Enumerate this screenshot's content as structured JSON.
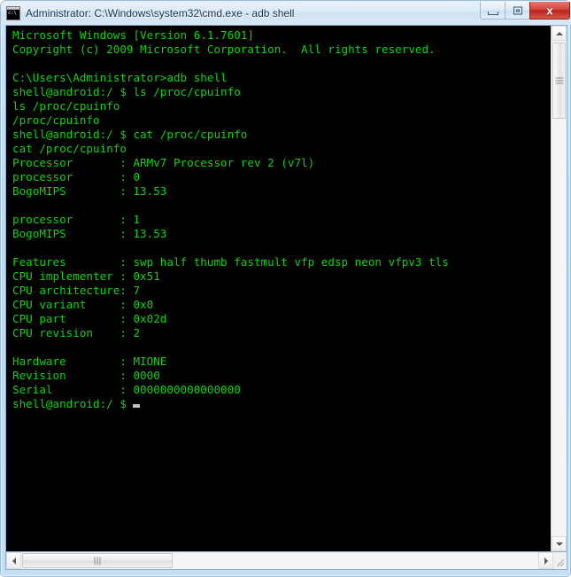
{
  "window": {
    "title": "Administrator: C:\\Windows\\system32\\cmd.exe - adb  shell",
    "icon": "cmd-console-icon",
    "frame_color": "#c6ddf2",
    "controls": {
      "minimize_label": "",
      "maximize_label": "",
      "close_label": "x"
    }
  },
  "console": {
    "background_color": "#000000",
    "text_color": "#12d412",
    "cursor_color": "#c4c4c4",
    "lines": [
      "Microsoft Windows [Version 6.1.7601]",
      "Copyright (c) 2009 Microsoft Corporation.  All rights reserved.",
      "",
      "C:\\Users\\Administrator>adb shell",
      "shell@android:/ $ ls /proc/cpuinfo",
      "ls /proc/cpuinfo",
      "/proc/cpuinfo",
      "shell@android:/ $ cat /proc/cpuinfo",
      "cat /proc/cpuinfo",
      "Processor       : ARMv7 Processor rev 2 (v7l)",
      "processor       : 0",
      "BogoMIPS        : 13.53",
      "",
      "processor       : 1",
      "BogoMIPS        : 13.53",
      "",
      "Features        : swp half thumb fastmult vfp edsp neon vfpv3 tls",
      "CPU implementer : 0x51",
      "CPU architecture: 7",
      "CPU variant     : 0x0",
      "CPU part        : 0x02d",
      "CPU revision    : 2",
      "",
      "Hardware        : MIONE",
      "Revision        : 0000",
      "Serial          : 0000000000000000"
    ],
    "prompt": "shell@android:/ $ "
  },
  "scrollbars": {
    "vertical": {
      "up_arrow": "scroll-up-arrow",
      "down_arrow": "scroll-down-arrow",
      "thumb_position_percent": 0
    },
    "horizontal": {
      "left_arrow": "scroll-left-arrow",
      "right_arrow": "scroll-right-arrow",
      "thumb_position_percent": 0
    }
  }
}
